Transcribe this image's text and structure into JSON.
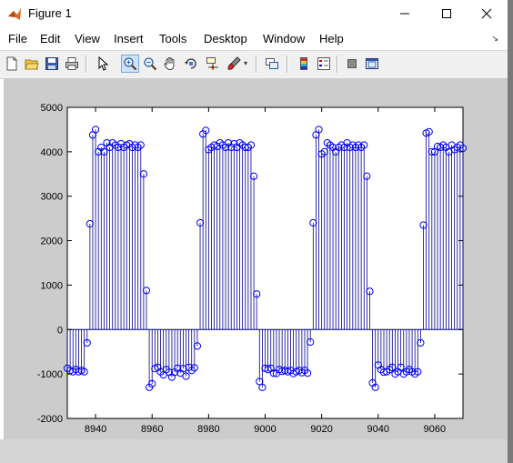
{
  "window": {
    "title": "Figure 1"
  },
  "menu": [
    "File",
    "Edit",
    "View",
    "Insert",
    "Tools",
    "Desktop",
    "Window",
    "Help"
  ],
  "toolbar": {
    "buttons": [
      "new-figure-icon",
      "open-file-icon",
      "save-icon",
      "print-icon",
      "edit-plot-arrow-icon",
      "zoom-in-icon",
      "zoom-out-icon",
      "pan-icon",
      "rotate-3d-icon",
      "data-cursor-icon",
      "brush-icon",
      "link-plot-icon",
      "colorbar-icon",
      "legend-icon",
      "hide-plot-tools-icon",
      "show-plot-tools-icon"
    ],
    "active": "zoom-in-icon"
  },
  "colors": {
    "stem": "#00008b",
    "marker": "#0000ff",
    "figure_bg": "#cccccc",
    "axes_bg": "#ffffff"
  },
  "chart_data": {
    "type": "stem",
    "title": "",
    "xlabel": "",
    "ylabel": "",
    "xlim": [
      8930,
      9070
    ],
    "ylim": [
      -2000,
      5000
    ],
    "xticks": [
      8940,
      8960,
      8980,
      9000,
      9020,
      9040,
      9060
    ],
    "yticks": [
      -2000,
      -1000,
      0,
      1000,
      2000,
      3000,
      4000,
      5000
    ],
    "grid": false,
    "baseline": 0,
    "x_start": 8930,
    "x_step": 1,
    "values": [
      -870,
      -920,
      -950,
      -900,
      -950,
      -920,
      -950,
      -300,
      2380,
      4380,
      4500,
      4000,
      4100,
      4000,
      4200,
      4100,
      4200,
      4150,
      4100,
      4180,
      4100,
      4150,
      4180,
      4100,
      4150,
      4100,
      4150,
      3500,
      880,
      -1300,
      -1220,
      -880,
      -850,
      -950,
      -1020,
      -900,
      -960,
      -1070,
      -960,
      -870,
      -980,
      -880,
      -1050,
      -850,
      -920,
      -860,
      -370,
      2400,
      4400,
      4480,
      4050,
      4100,
      4150,
      4120,
      4200,
      4150,
      4100,
      4200,
      4100,
      4180,
      4100,
      4200,
      4150,
      4100,
      4100,
      4150,
      3450,
      800,
      -1170,
      -1300,
      -870,
      -900,
      -870,
      -980,
      -990,
      -900,
      -940,
      -920,
      -950,
      -920,
      -990,
      -950,
      -920,
      -970,
      -920,
      -980,
      -280,
      2400,
      4380,
      4500,
      3950,
      4000,
      4200,
      4150,
      4100,
      4000,
      4100,
      4150,
      4100,
      4200,
      4100,
      4150,
      4100,
      4150,
      4100,
      4150,
      3450,
      860,
      -1200,
      -1300,
      -800,
      -900,
      -960,
      -950,
      -900,
      -850,
      -1000,
      -950,
      -850,
      -1000,
      -950,
      -900,
      -950,
      -1000,
      -950,
      -300,
      2350,
      4420,
      4450,
      4000,
      4000,
      4120,
      4100,
      4150,
      4100,
      4000,
      4150,
      4050,
      4100,
      4150,
      4080,
      4180
    ]
  }
}
